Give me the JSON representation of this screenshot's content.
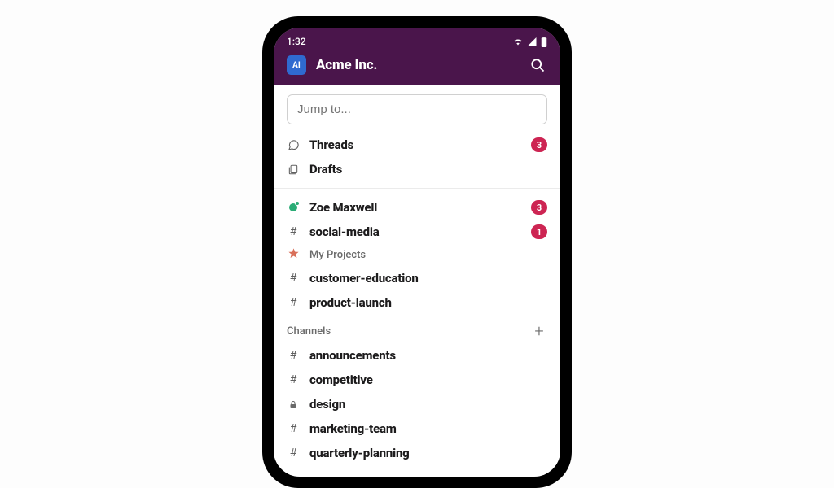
{
  "status": {
    "time": "1:32"
  },
  "workspace": {
    "avatar_label": "AI",
    "name": "Acme Inc."
  },
  "search": {
    "placeholder": "Jump to..."
  },
  "top_items": [
    {
      "icon": "threads",
      "label": "Threads",
      "badge": "3"
    },
    {
      "icon": "drafts",
      "label": "Drafts",
      "badge": ""
    }
  ],
  "unreads": [
    {
      "icon": "presence",
      "label": "Zoe Maxwell",
      "badge": "3"
    },
    {
      "icon": "hash",
      "label": "social-media",
      "badge": "1"
    }
  ],
  "sections": [
    {
      "title": "My Projects",
      "icon": "star",
      "has_add": false,
      "items": [
        {
          "icon": "hash",
          "label": "customer-education"
        },
        {
          "icon": "hash",
          "label": "product-launch"
        }
      ]
    },
    {
      "title": "Channels",
      "icon": "",
      "has_add": true,
      "items": [
        {
          "icon": "hash",
          "label": "announcements"
        },
        {
          "icon": "hash",
          "label": "competitive"
        },
        {
          "icon": "lock",
          "label": "design"
        },
        {
          "icon": "hash",
          "label": "marketing-team"
        },
        {
          "icon": "hash",
          "label": "quarterly-planning"
        }
      ]
    }
  ]
}
